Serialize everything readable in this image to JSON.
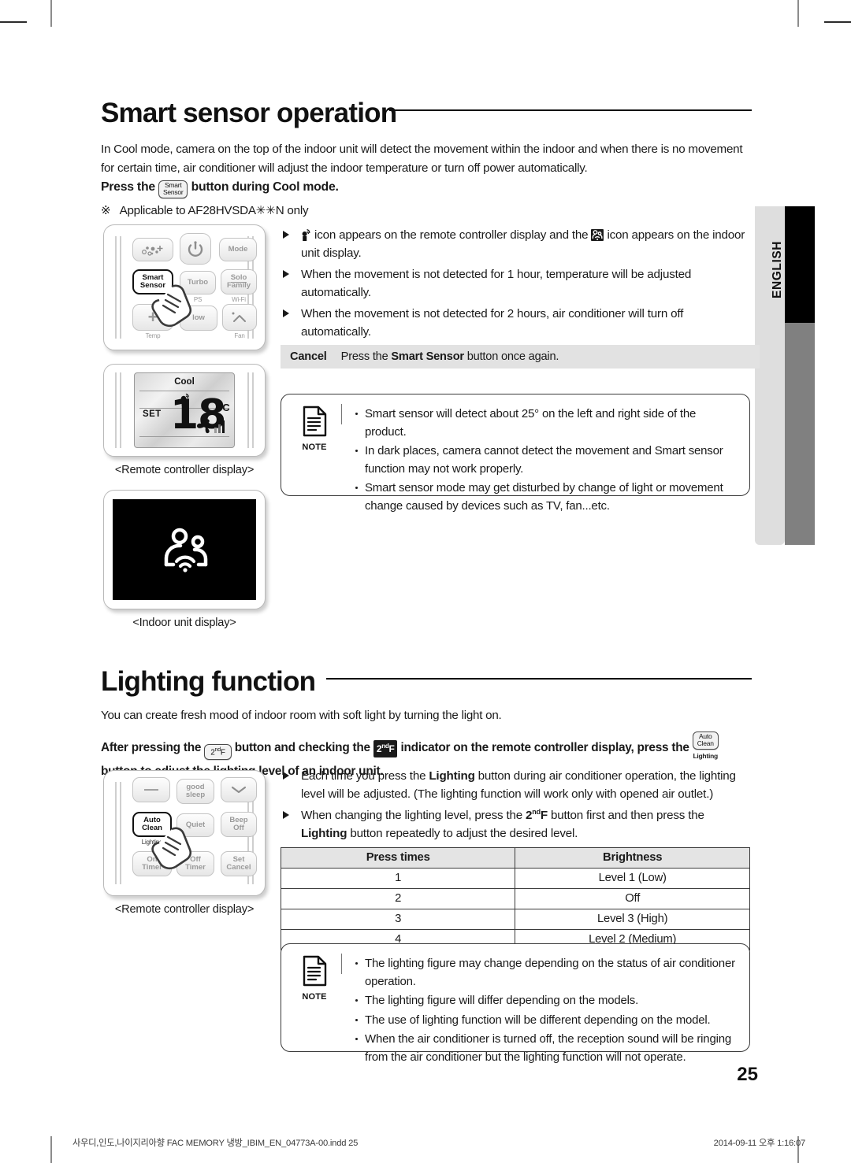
{
  "page": {
    "number": "25",
    "language_tab": "ENGLISH"
  },
  "sections": [
    {
      "title": "Smart sensor operation",
      "intro": "In Cool mode, camera on the top of the indoor unit will detect the movement within the indoor and when there is no movement for certain time, air conditioner will adjust the indoor temperature or turn off power automatically.",
      "instruction_pre": "Press the",
      "instruction_key": {
        "line1": "Smart",
        "line2": "Sensor"
      },
      "instruction_post": "button during Cool mode.",
      "applicable_mark": "※",
      "applicable": "Applicable to AF28HVSDA✳✳N only",
      "bullets": [
        "icon appears on the remote controller display and the  icon appears on the indoor unit display.",
        "When the movement is not detected for 1 hour, temperature will be adjusted automatically.",
        "When the movement is not detected for 2 hours, air conditioner will turn off automatically."
      ],
      "bullet0_parts": {
        "a": "icon appears on the remote controller display and the",
        "b": "icon appears on the indoor unit display."
      },
      "cancel": {
        "label": "Cancel",
        "pre": "Press the",
        "bold": "Smart Sensor",
        "post": "button once again."
      },
      "note": {
        "label": "NOTE",
        "items": [
          "Smart sensor will detect about 25° on the left and right side of the product.",
          "In dark places, camera cannot detect the movement and Smart sensor function may not work properly.",
          "Smart sensor mode may get disturbed by change of light or movement change caused by devices such as TV, fan...etc."
        ]
      },
      "figures": {
        "remote": {
          "caption": "",
          "buttons": [
            {
              "name": "blow-icon",
              "label": ""
            },
            {
              "name": "power",
              "label": ""
            },
            {
              "name": "mode",
              "label": "Mode"
            },
            {
              "name": "smart-sensor",
              "label": "Smart\nSensor",
              "active": true
            },
            {
              "name": "turbo",
              "label": "Turbo"
            },
            {
              "name": "solo-family",
              "label": "Solo\nFamily"
            },
            {
              "name": "temp-up",
              "label": "+"
            },
            {
              "name": "low",
              "label": "low"
            },
            {
              "name": "fan",
              "label": ""
            }
          ],
          "sublabels": [
            "PS",
            "Wi-Fi",
            "Temp",
            "Fan"
          ]
        },
        "lcd": {
          "mode": "Cool",
          "set": "SET",
          "temperature": "18",
          "unit": "°C",
          "caption": "<Remote controller display>"
        },
        "indoor": {
          "caption": "<Indoor unit display>"
        }
      }
    },
    {
      "title": "Lighting function",
      "intro": "You can create fresh mood of indoor room with soft light by turning the light on.",
      "instruction": {
        "p1": "After pressing the",
        "key1": {
          "text": "2",
          "sup": "nd",
          "tail": "F"
        },
        "p2": "button and checking the",
        "key2": {
          "text": "2",
          "sup": "nd",
          "tail": "F"
        },
        "p3": "indicator on the remote controller display, press the",
        "key3": {
          "line1": "Auto",
          "line2": "Clean",
          "sub": "Lighting"
        },
        "p4": "button",
        "p5": "to adjust the lighting level of an indoor unit."
      },
      "bullets": [
        {
          "pre": "Each time you press the ",
          "bold": "Lighting",
          "post": " button during air conditioner operation, the lighting level will be adjusted. (The lighting function will work only with opened air outlet.)"
        },
        {
          "pre": "When changing the lighting level, press the ",
          "bold2": "2ndF",
          "mid": " button first and then press the ",
          "bold3": "Lighting",
          "post": " button repeatedly to adjust the desired level."
        }
      ],
      "table": {
        "headers": [
          "Press times",
          "Brightness"
        ],
        "rows": [
          [
            "1",
            "Level 1 (Low)"
          ],
          [
            "2",
            "Off"
          ],
          [
            "3",
            "Level 3 (High)"
          ],
          [
            "4",
            "Level 2 (Medium)"
          ]
        ]
      },
      "note": {
        "label": "NOTE",
        "items": [
          "The lighting figure may change depending on the status of air conditioner operation.",
          "The lighting figure will differ depending on the models.",
          "The use of lighting function will be different depending on the model.",
          "When the air conditioner is turned off, the reception sound will be ringing from the air conditioner but the lighting function will not operate."
        ]
      },
      "figure": {
        "caption": "<Remote controller display>",
        "buttons": [
          {
            "name": "minus",
            "label": "—"
          },
          {
            "name": "good-sleep",
            "label": "good\nsleep"
          },
          {
            "name": "down",
            "label": "⌄"
          },
          {
            "name": "auto-clean",
            "label": "Auto\nClean",
            "active": true
          },
          {
            "name": "quiet",
            "label": "Quiet"
          },
          {
            "name": "beep-off",
            "label": "Beep\nOff"
          },
          {
            "name": "on-timer",
            "label": "On\nTimer"
          },
          {
            "name": "off-timer",
            "label": "Off\nTimer"
          },
          {
            "name": "set-cancel",
            "label": "Set\nCancel"
          }
        ],
        "sublabel": "Lighting"
      }
    }
  ],
  "footer": {
    "left": "사우디,인도,나이지리아향 FAC MEMORY 냉방_IBIM_EN_04773A-00.indd   25",
    "right": "2014-09-11   오후 1:16:07"
  }
}
